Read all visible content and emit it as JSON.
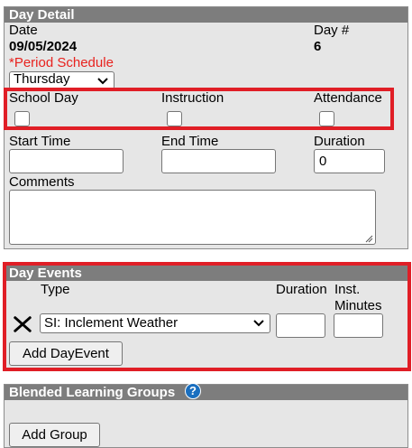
{
  "day_detail": {
    "header": "Day Detail",
    "date_label": "Date",
    "date_value": "09/05/2024",
    "day_num_label": "Day #",
    "day_num_value": "6",
    "period_schedule_label": "*Period Schedule",
    "period_schedule_value": "Thursday",
    "school_day_label": "School Day",
    "instruction_label": "Instruction",
    "attendance_label": "Attendance",
    "start_time_label": "Start Time",
    "start_time_value": "",
    "end_time_label": "End Time",
    "end_time_value": "",
    "duration_label": "Duration",
    "duration_value": "0",
    "comments_label": "Comments",
    "comments_value": ""
  },
  "day_events": {
    "header": "Day Events",
    "type_label": "Type",
    "duration_label": "Duration",
    "inst_label": "Inst.",
    "minutes_label": "Minutes",
    "rows": [
      {
        "type": "SI: Inclement Weather",
        "duration": "",
        "inst_minutes": ""
      }
    ],
    "add_button": "Add DayEvent"
  },
  "blended": {
    "header": "Blended Learning Groups",
    "help_icon_glyph": "?",
    "add_button": "Add Group"
  },
  "colors": {
    "header_bg": "#7d7d7d",
    "panel_bg": "#e6e6e6",
    "required_text": "#e8221e",
    "highlight_border": "#e01e26",
    "help_icon": "#1a6fbf"
  }
}
